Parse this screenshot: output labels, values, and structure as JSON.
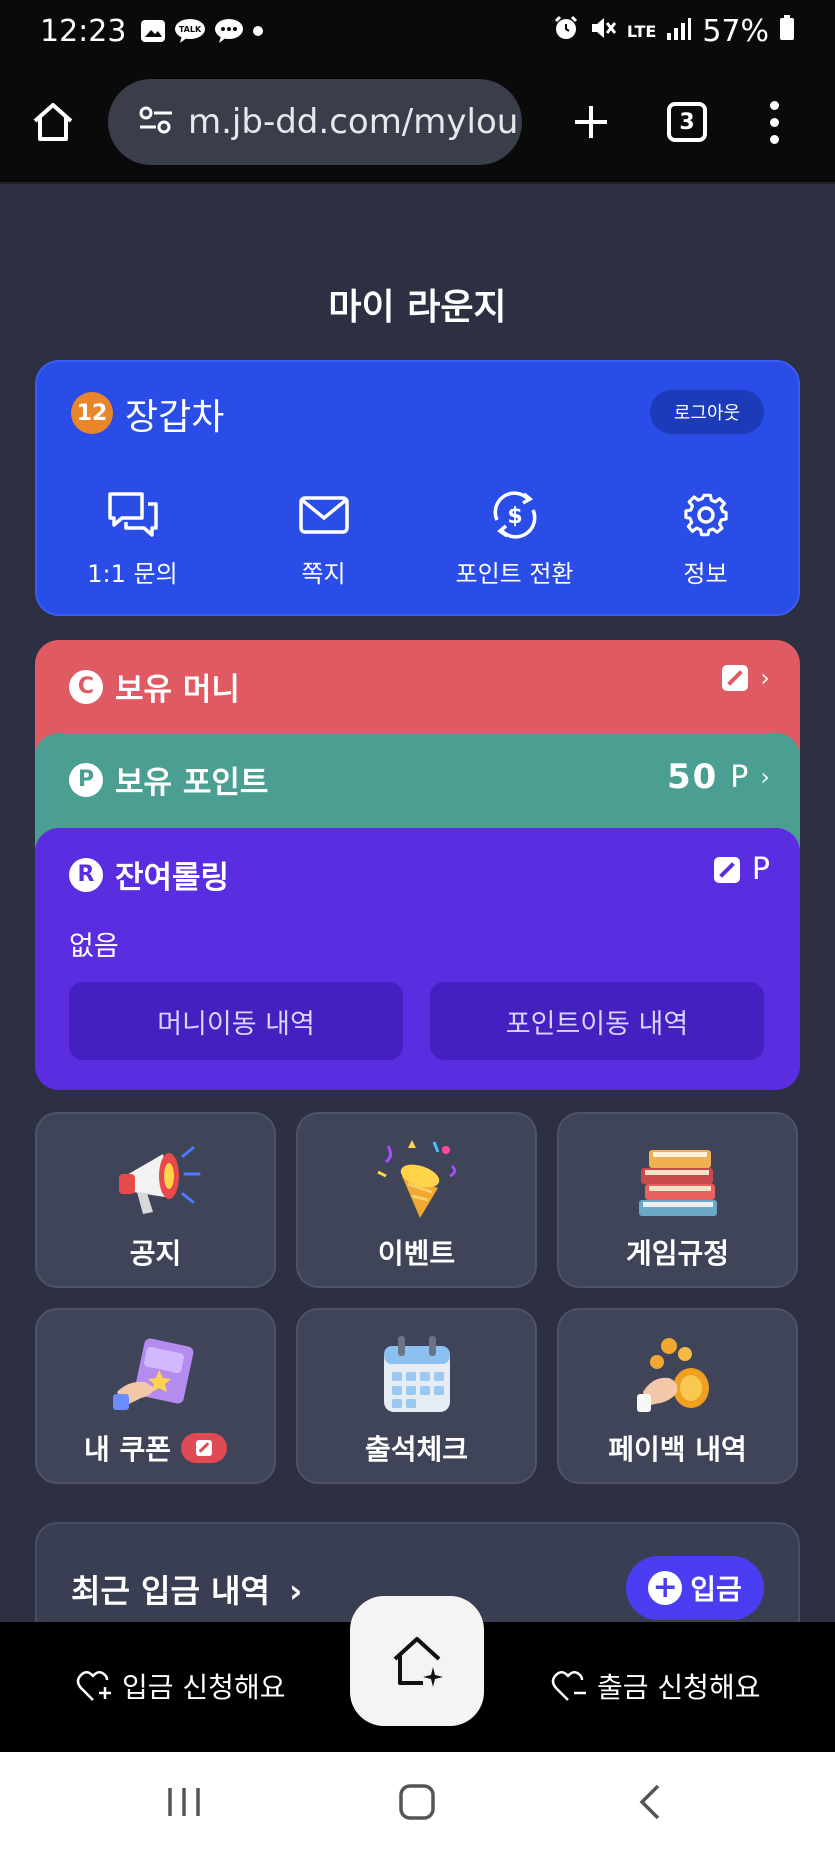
{
  "status_bar": {
    "time": "12:23",
    "battery": "57%",
    "network": "LTE"
  },
  "browser": {
    "url": "m.jb-dd.com/mylou",
    "tab_count": "3"
  },
  "page": {
    "title": "마이 라운지"
  },
  "profile": {
    "level": "12",
    "username": "장갑차",
    "logout_label": "로그아웃",
    "actions": [
      {
        "label": "1:1 문의",
        "icon": "chat-icon"
      },
      {
        "label": "쪽지",
        "icon": "mail-icon"
      },
      {
        "label": "포인트 전환",
        "icon": "exchange-icon"
      },
      {
        "label": "정보",
        "icon": "gear-icon"
      }
    ]
  },
  "money_card": {
    "badge": "C",
    "title": "보유 머니",
    "color": "#e05a64"
  },
  "points_card": {
    "badge": "P",
    "title": "보유 포인트",
    "value": "50",
    "unit": "P",
    "color": "#4a9e92"
  },
  "rolling_card": {
    "badge": "R",
    "title": "잔여롤링",
    "unit": "P",
    "status": "없음",
    "money_history_label": "머니이동 내역",
    "point_history_label": "포인트이동 내역",
    "color": "#5a2de0"
  },
  "tiles": [
    {
      "label": "공지",
      "icon": "megaphone-icon"
    },
    {
      "label": "이벤트",
      "icon": "party-popper-icon"
    },
    {
      "label": "게임규정",
      "icon": "books-icon"
    },
    {
      "label": "내 쿠폰",
      "icon": "coupon-icon"
    },
    {
      "label": "출석체크",
      "icon": "calendar-icon"
    },
    {
      "label": "페이백 내역",
      "icon": "coins-icon"
    }
  ],
  "recent_deposit": {
    "title": "최근 입금 내역",
    "deposit_button": "입금"
  },
  "app_nav": {
    "deposit_request": "입금 신청해요",
    "withdraw_request": "출금 신청해요"
  }
}
